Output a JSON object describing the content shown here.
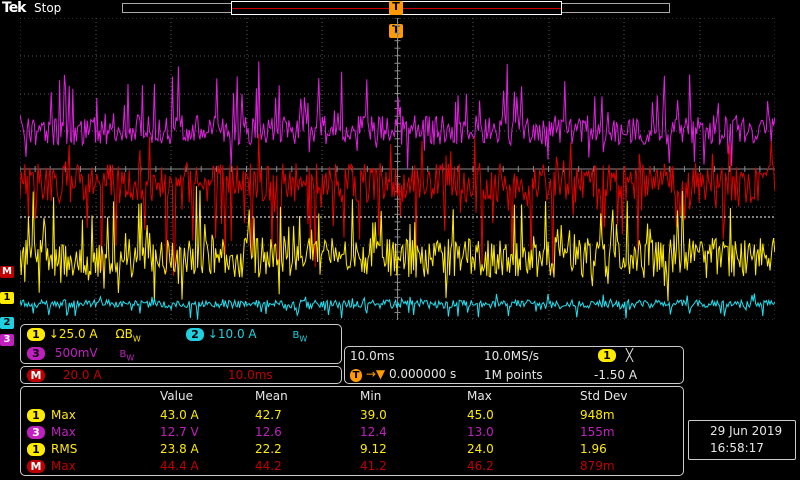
{
  "header": {
    "logo": "Tek",
    "run_state": "Stop",
    "trigger_marker": "T"
  },
  "colors": {
    "ch1": "#ffeb00",
    "ch2": "#20d0e0",
    "ch3": "#c020c0",
    "math": "#c00000",
    "grid": "#6a6a6a"
  },
  "markers": {
    "math": "M",
    "ch1": "1",
    "ch2": "2",
    "ch3": "3",
    "trigger": "T"
  },
  "channels": {
    "ch1": {
      "num": "1",
      "scale": "↓25.0 A",
      "bw": "ΩB",
      "bw_sub": "W"
    },
    "ch2": {
      "num": "2",
      "scale": "↓10.0 A",
      "bw": "B",
      "bw_sub": "W"
    },
    "ch3": {
      "num": "3",
      "scale": "500mV",
      "bw": "B",
      "bw_sub": "W"
    },
    "math": {
      "label": "M",
      "scale": "20.0 A",
      "time": "10.0ms"
    }
  },
  "timebase": {
    "scale": "10.0ms",
    "rate": "10.0MS/s",
    "delay": "0.000000 s",
    "points": "1M points",
    "trig_source": "1",
    "trig_icon": "╳",
    "trig_level": "-1.50 A"
  },
  "measurements": {
    "headers": [
      "Value",
      "Mean",
      "Min",
      "Max",
      "Std Dev"
    ],
    "rows": [
      {
        "src": "1",
        "type": "Max",
        "color": "y",
        "values": [
          "43.0 A",
          "42.7",
          "39.0",
          "45.0",
          "948m"
        ]
      },
      {
        "src": "3",
        "type": "Max",
        "color": "m",
        "values": [
          "12.7 V",
          "12.6",
          "12.4",
          "13.0",
          "155m"
        ]
      },
      {
        "src": "1",
        "type": "RMS",
        "color": "y",
        "values": [
          "23.8 A",
          "22.2",
          "9.12",
          "24.0",
          "1.96"
        ]
      },
      {
        "src": "M",
        "type": "Max",
        "color": "r",
        "values": [
          "44.4 A",
          "44.2",
          "41.2",
          "46.2",
          "879m"
        ]
      }
    ]
  },
  "datetime": {
    "date": "29 Jun  2019",
    "time": "16:58:17"
  }
}
